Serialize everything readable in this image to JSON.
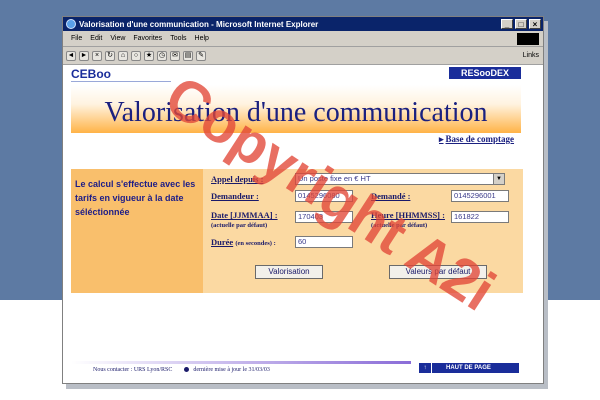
{
  "window": {
    "title": "Valorisation d'une communication - Microsoft Internet Explorer",
    "controls": [
      "_",
      "□",
      "×"
    ]
  },
  "menu": [
    "File",
    "Edit",
    "View",
    "Favorites",
    "Tools",
    "Help"
  ],
  "toolbar": {
    "links_label": "Links"
  },
  "page": {
    "brand_left": "CEBoo",
    "brand_right": "RESooDEX",
    "heading": "Valorisation d'une communication",
    "base_link": "Base de comptage",
    "side_text": "Le calcul s'effectue avec les tarifs en vigueur à la date séléctionnée"
  },
  "form": {
    "appel_label": "Appel depuis :",
    "appel_value": "Un poste fixe en € HT",
    "demandeur_label": "Demandeur :",
    "demandeur_value": "0145296080",
    "demande_label": "Demandé :",
    "demande_value": "0145296001",
    "date_label": "Date [JJMMAA] :",
    "date_sub": "(actuelle par défaut)",
    "date_value": "170403",
    "heure_label": "Heure [HHMMSS] :",
    "heure_sub": "(actuelle par défaut)",
    "heure_value": "161822",
    "duree_label": "Durée",
    "duree_unit": "(en secondes) :",
    "duree_value": "60",
    "valorisation_button": "Valorisation",
    "defaults_button": "Valeurs par défaut"
  },
  "footer": {
    "contact": "Nous contacter : URS Lyon/RSC",
    "update": "dernière mise à jour le 31/03/03",
    "top_button": "HAUT DE PAGE"
  },
  "watermark": "Copyright A2i",
  "colors": {
    "background": "#5d7aa3",
    "panel": "#f9bf6c",
    "form": "#fbd9a2",
    "heading": "#1a2080",
    "watermark": "#e14637"
  }
}
